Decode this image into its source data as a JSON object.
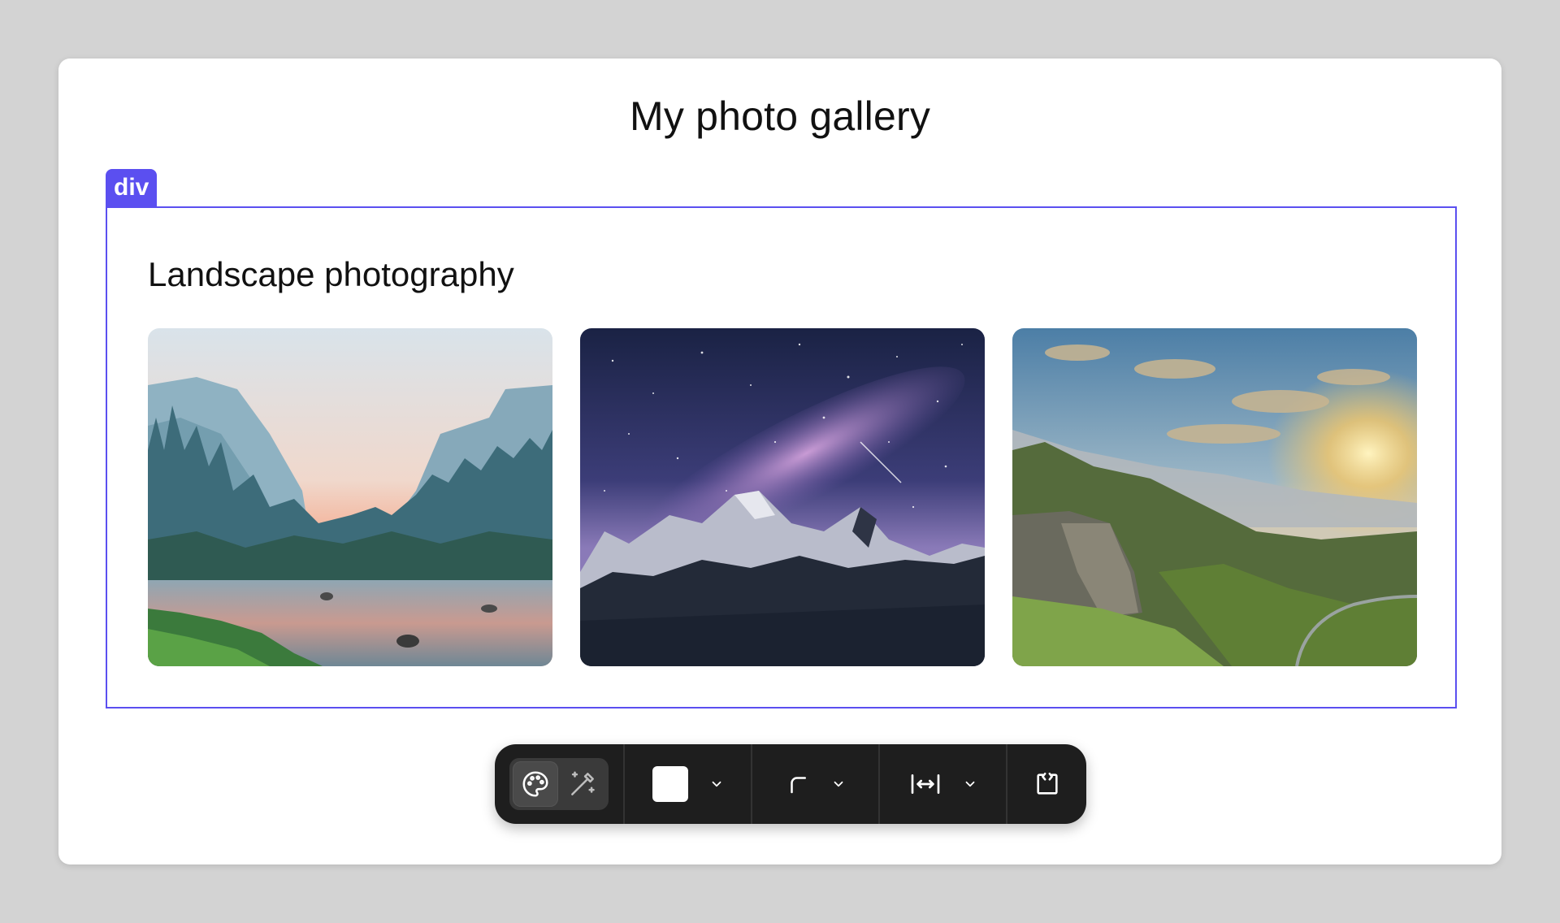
{
  "page": {
    "title": "My photo gallery"
  },
  "selection": {
    "tag": "div",
    "accent": "#5b4ff0"
  },
  "section": {
    "title": "Landscape photography",
    "photos": [
      {
        "subject": "valley-river-mountains-icon"
      },
      {
        "subject": "milky-way-mountains-icon"
      },
      {
        "subject": "green-cliffs-sunset-icon"
      }
    ]
  },
  "toolbar": {
    "background": "#1e1e1e",
    "items": [
      {
        "icon": "palette-icon"
      },
      {
        "icon": "magic-wand-icon"
      },
      {
        "icon": "color-swatch",
        "value": "#ffffff"
      },
      {
        "icon": "corner-radius-icon"
      },
      {
        "icon": "spacing-icon"
      },
      {
        "icon": "code-icon"
      }
    ]
  }
}
